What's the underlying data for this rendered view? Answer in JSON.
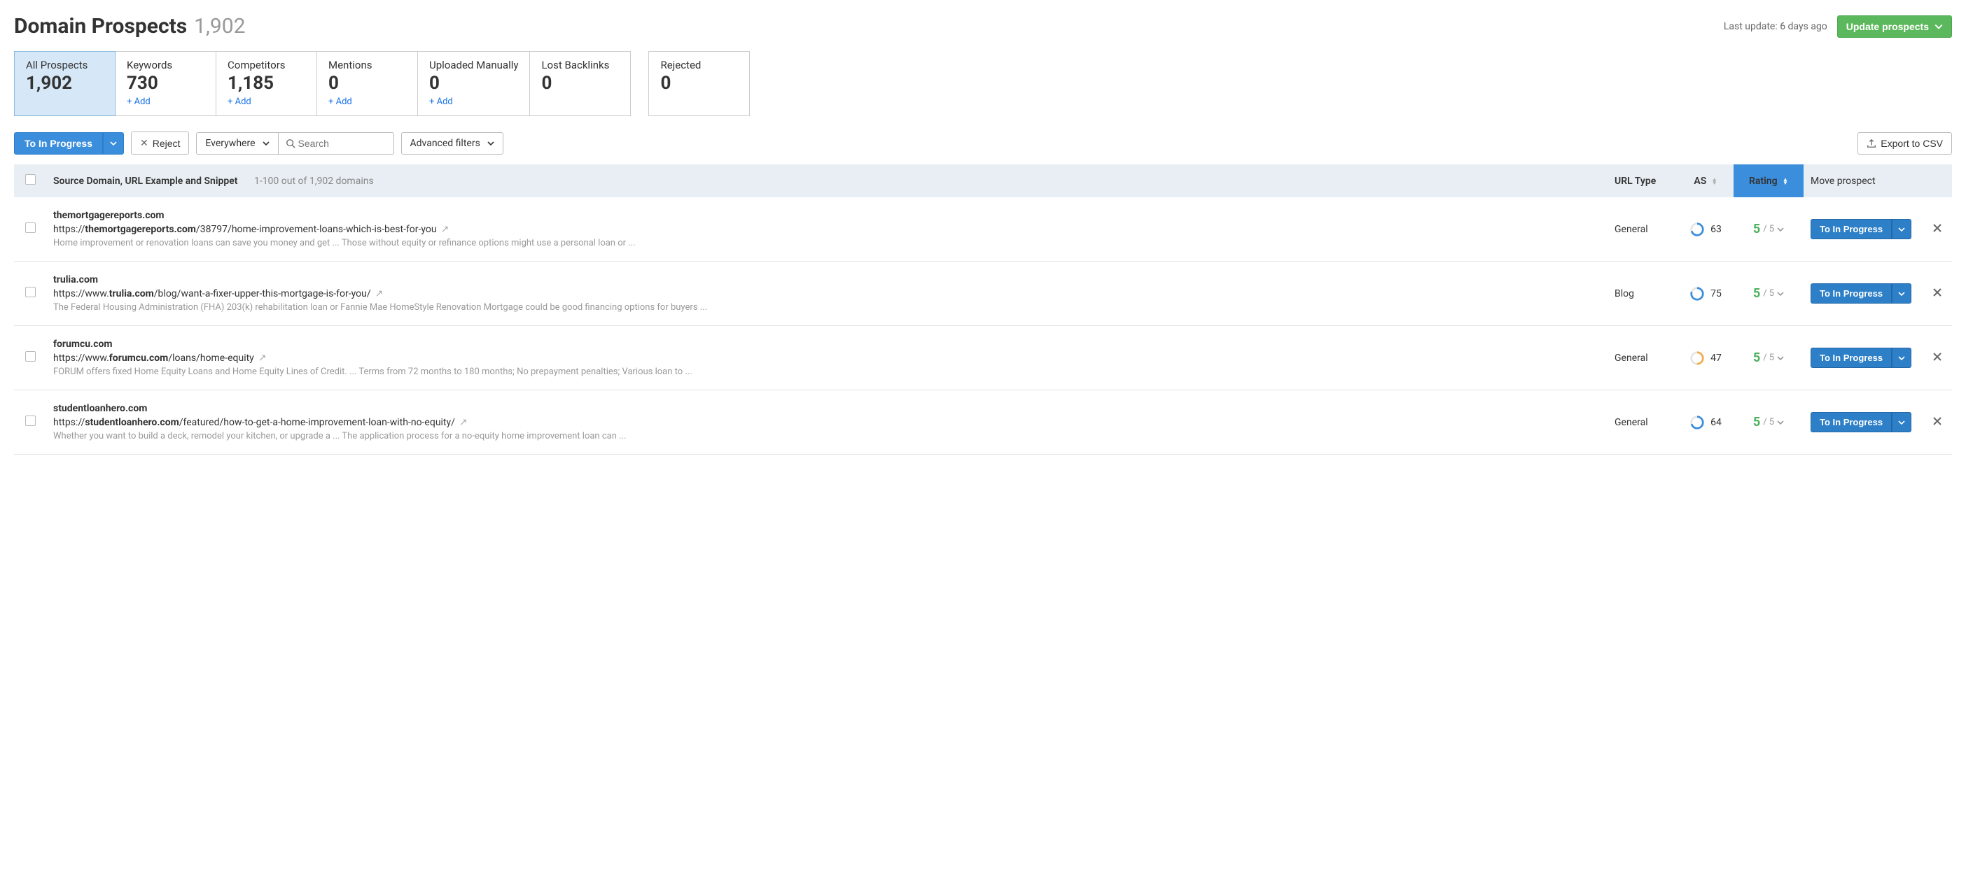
{
  "header": {
    "title": "Domain Prospects",
    "count": "1,902",
    "last_update": "Last update: 6 days ago",
    "update_button": "Update prospects"
  },
  "stats": [
    {
      "label": "All Prospects",
      "value": "1,902",
      "add": "",
      "active": true
    },
    {
      "label": "Keywords",
      "value": "730",
      "add": "+ Add",
      "active": false
    },
    {
      "label": "Competitors",
      "value": "1,185",
      "add": "+ Add",
      "active": false
    },
    {
      "label": "Mentions",
      "value": "0",
      "add": "+ Add",
      "active": false
    },
    {
      "label": "Uploaded Manually",
      "value": "0",
      "add": "+ Add",
      "active": false
    },
    {
      "label": "Lost Backlinks",
      "value": "0",
      "add": "",
      "active": false,
      "gap_after": true
    },
    {
      "label": "Rejected",
      "value": "0",
      "add": "",
      "active": false
    }
  ],
  "toolbar": {
    "to_in_progress": "To In Progress",
    "reject": "Reject",
    "everywhere": "Everywhere",
    "search_placeholder": "Search",
    "advanced_filters": "Advanced filters",
    "export": "Export to CSV"
  },
  "table_head": {
    "source": "Source Domain, URL Example and Snippet",
    "range": "1-100 out of 1,902 domains",
    "url_type": "URL Type",
    "as": "AS",
    "rating": "Rating",
    "move": "Move prospect"
  },
  "rows": [
    {
      "domain": "themortgagereports.com",
      "url_prefix": "https://",
      "url_bold": "themortgagereports.com",
      "url_rest": "/38797/home-improvement-loans-which-is-best-for-you",
      "snippet": "Home improvement or renovation loans can save you money and get ... Those without equity or refinance options might use a personal loan or ...",
      "url_type": "General",
      "as": "63",
      "ring_color": "#3b8edb",
      "ring_pct": 0.7,
      "rating": "5",
      "rating_max": "/ 5",
      "move_label": "To In Progress"
    },
    {
      "domain": "trulia.com",
      "url_prefix": "https://www.",
      "url_bold": "trulia.com",
      "url_rest": "/blog/want-a-fixer-upper-this-mortgage-is-for-you/",
      "snippet": "The Federal Housing Administration (FHA) 203(k) rehabilitation loan or Fannie Mae HomeStyle Renovation Mortgage could be good financing options for buyers ...",
      "url_type": "Blog",
      "as": "75",
      "ring_color": "#3b8edb",
      "ring_pct": 0.8,
      "rating": "5",
      "rating_max": "/ 5",
      "move_label": "To In Progress"
    },
    {
      "domain": "forumcu.com",
      "url_prefix": "https://www.",
      "url_bold": "forumcu.com",
      "url_rest": "/loans/home-equity",
      "snippet": "FORUM offers fixed Home Equity Loans and Home Equity Lines of Credit. ... Terms from 72 months to 180 months; No prepayment penalties; Various loan to ...",
      "url_type": "General",
      "as": "47",
      "ring_color": "#f0ad4e",
      "ring_pct": 0.5,
      "rating": "5",
      "rating_max": "/ 5",
      "move_label": "To In Progress"
    },
    {
      "domain": "studentloanhero.com",
      "url_prefix": "https://",
      "url_bold": "studentloanhero.com",
      "url_rest": "/featured/how-to-get-a-home-improvement-loan-with-no-equity/",
      "snippet": "Whether you want to build a deck, remodel your kitchen, or upgrade a ... The application process for a no-equity home improvement loan can ...",
      "url_type": "General",
      "as": "64",
      "ring_color": "#3b8edb",
      "ring_pct": 0.7,
      "rating": "5",
      "rating_max": "/ 5",
      "move_label": "To In Progress"
    }
  ]
}
